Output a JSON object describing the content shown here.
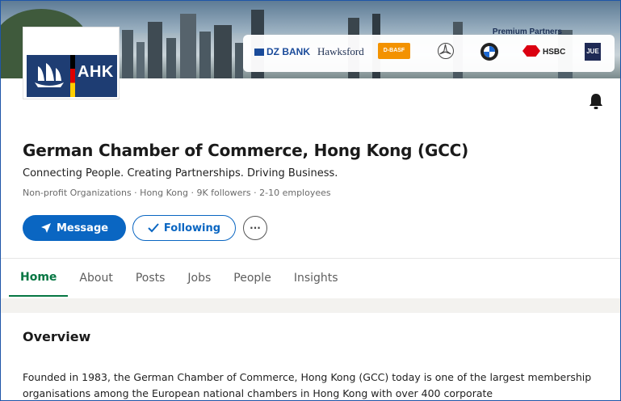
{
  "banner": {
    "partners_title": "Premium Partners",
    "partners": {
      "dz": "DZ BANK",
      "hawksford": "Hawksford",
      "basf": "D-BASF",
      "hsbc": "HSBC",
      "jue": "JUE"
    }
  },
  "logo": {
    "text": "AHK"
  },
  "company": {
    "name": "German Chamber of Commerce, Hong Kong (GCC)",
    "tagline": "Connecting People. Creating Partnerships. Driving Business.",
    "meta": "Non-profit Organizations · Hong Kong · 9K followers · 2-10 employees"
  },
  "actions": {
    "message": "Message",
    "following": "Following",
    "more": "···"
  },
  "tabs": [
    {
      "label": "Home"
    },
    {
      "label": "About"
    },
    {
      "label": "Posts"
    },
    {
      "label": "Jobs"
    },
    {
      "label": "People"
    },
    {
      "label": "Insights"
    }
  ],
  "overview": {
    "heading": "Overview",
    "text": "Founded in 1983, the German Chamber of Commerce, Hong Kong (GCC) today is one of the largest membership organisations among the European national chambers in Hong Kong with over 400 corporate"
  },
  "colors": {
    "primary": "#0a66c2",
    "active_tab": "#057642",
    "logo_bg": "#1e3d73"
  }
}
